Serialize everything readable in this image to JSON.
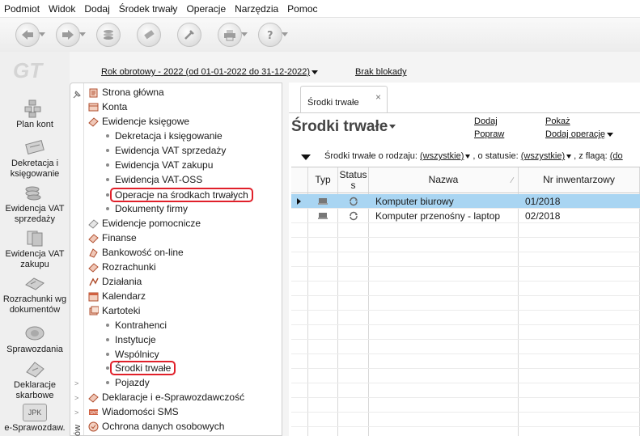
{
  "menu": [
    "Podmiot",
    "Widok",
    "Dodaj",
    "Środek trwały",
    "Operacje",
    "Narzędzia",
    "Pomoc"
  ],
  "header": {
    "fiscal_year": "Rok obrotowy - 2022  (od 01-01-2022 do 31-12-2022)",
    "lock_status": "Brak blokady"
  },
  "sidebar": [
    "Plan kont",
    "Dekretacja i księgowanie",
    "Ewidencja VAT sprzedaży",
    "Ewidencja VAT zakupu",
    "Rozrachunki wg dokumentów",
    "Sprawozdania",
    "Deklaracje skarbowe",
    "e-Sprawozdaw."
  ],
  "sidebar_partial": {
    "jpk_label": "JPK",
    "logo": "GT"
  },
  "tree": [
    {
      "label": "Strona główna"
    },
    {
      "label": "Konta"
    },
    {
      "label": "Ewidencje księgowe"
    },
    {
      "label": "Dekretacja i księgowanie"
    },
    {
      "label": "Ewidencja VAT sprzedaży"
    },
    {
      "label": "Ewidencja VAT zakupu"
    },
    {
      "label": "Ewidencja VAT-OSS"
    },
    {
      "label": "Operacje na środkach trwałych"
    },
    {
      "label": "Dokumenty firmy"
    },
    {
      "label": "Ewidencje pomocnicze"
    },
    {
      "label": "Finanse"
    },
    {
      "label": "Bankowość on-line"
    },
    {
      "label": "Rozrachunki"
    },
    {
      "label": "Działania"
    },
    {
      "label": "Kalendarz"
    },
    {
      "label": "Kartoteki"
    },
    {
      "label": "Kontrahenci"
    },
    {
      "label": "Instytucje"
    },
    {
      "label": "Wspólnicy"
    },
    {
      "label": "Środki trwałe"
    },
    {
      "label": "Pojazdy"
    },
    {
      "label": "Deklaracje i e-Sprawozdawczość"
    },
    {
      "label": "Wiadomości SMS"
    },
    {
      "label": "Ochrona danych osobowych"
    }
  ],
  "strip_label": "ów",
  "content": {
    "tab_label": "Środki trwałe",
    "tab_close": "×",
    "title": "Środki trwałe",
    "actions": {
      "add": "Dodaj",
      "show": "Pokaż",
      "edit": "Popraw",
      "add_operation": "Dodaj operację"
    },
    "filter": {
      "kind_label": "Środki trwałe o rodzaju:",
      "kind_value": "(wszystkie)",
      "status_label": ", o statusie:",
      "status_value": "(wszystkie)",
      "flag_label": ", z flagą:",
      "flag_value": "(do"
    },
    "columns": {
      "type": "Typ",
      "status_1": "Status",
      "status_2": "s",
      "name": "Nazwa",
      "inv": "Nr inwentarzowy",
      "sort_mark": "∕"
    },
    "rows": [
      {
        "name": "Komputer biurowy",
        "inv": "01/2018"
      },
      {
        "name": "Komputer przenośny - laptop",
        "inv": "02/2018"
      }
    ]
  },
  "colors": {
    "selected_row": "#a9d5f2",
    "highlight_box": "#e0202a"
  }
}
